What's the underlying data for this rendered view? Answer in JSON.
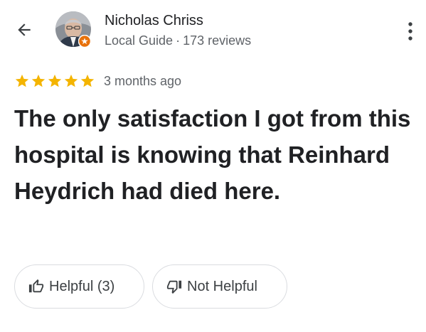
{
  "header": {
    "author_name": "Nicholas Chriss",
    "author_role": "Local Guide",
    "separator": "·",
    "review_count": "173 reviews"
  },
  "review": {
    "rating": 5,
    "rating_max": 5,
    "date": "3 months ago",
    "text": "The only satisfaction I got from this hospital is knowing that Reinhard Heydrich had died here."
  },
  "actions": {
    "helpful_label": "Helpful (3)",
    "not_helpful_label": "Not Helpful"
  },
  "colors": {
    "star": "#f4b400",
    "text_primary": "#202124",
    "text_secondary": "#5f6368",
    "chip_border": "#dadce0",
    "badge": "#e8710a"
  },
  "icons": {
    "back": "arrow-left-icon",
    "more": "more-vert-icon",
    "helpful": "thumb-up-icon",
    "not_helpful": "thumb-down-icon",
    "star": "star-icon",
    "badge": "local-guide-badge-icon"
  }
}
